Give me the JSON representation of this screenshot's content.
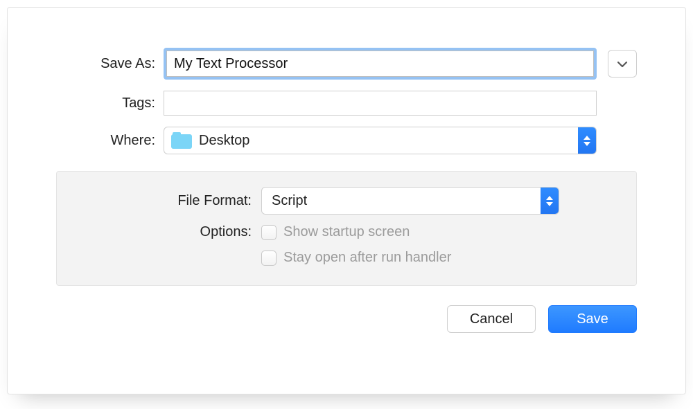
{
  "save_as": {
    "label": "Save As:",
    "value": "My Text Processor"
  },
  "tags": {
    "label": "Tags:",
    "value": ""
  },
  "where": {
    "label": "Where:",
    "value": "Desktop"
  },
  "file_format": {
    "label": "File Format:",
    "value": "Script"
  },
  "options": {
    "label": "Options:",
    "show_startup_screen": {
      "label": "Show startup screen",
      "checked": false
    },
    "stay_open": {
      "label": "Stay open after run handler",
      "checked": false
    }
  },
  "buttons": {
    "cancel": "Cancel",
    "save": "Save"
  }
}
